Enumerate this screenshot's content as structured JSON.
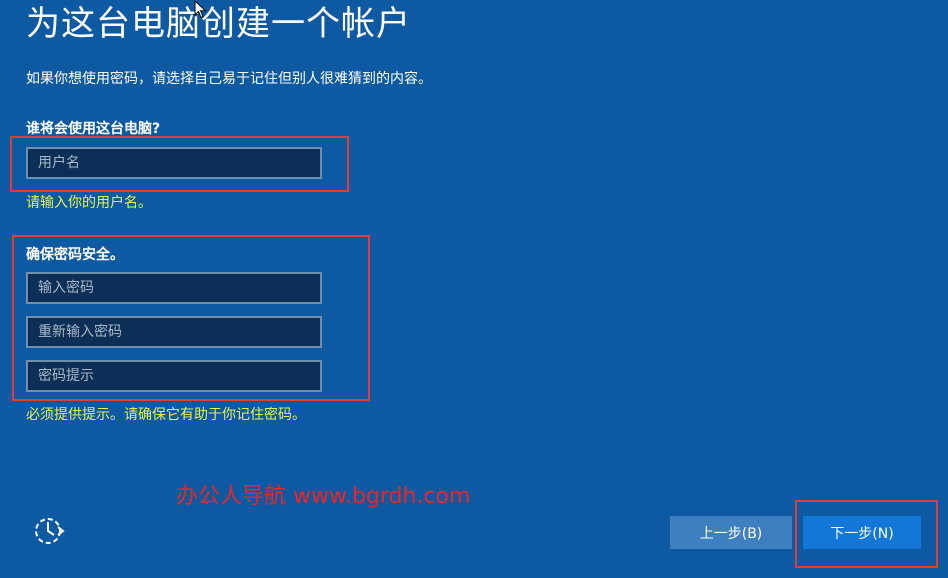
{
  "page": {
    "title": "为这台电脑创建一个帐户",
    "subtitle": "如果你想使用密码，请选择自己易于记住但别人很难猜到的内容。"
  },
  "username_section": {
    "label": "谁将会使用这台电脑?",
    "placeholder": "用户名",
    "value": "",
    "error": "请输入你的用户名。"
  },
  "password_section": {
    "label": "确保密码安全。",
    "password_placeholder": "输入密码",
    "confirm_placeholder": "重新输入密码",
    "hint_placeholder": "密码提示",
    "error": "必须提供提示。请确保它有助于你记住密码。"
  },
  "watermark": "办公人导航  www.bgrdh.com",
  "buttons": {
    "back": "上一步(B)",
    "next": "下一步(N)"
  },
  "icons": {
    "ease_of_access": "ease-of-access-icon",
    "cursor": "mouse-cursor-icon"
  },
  "colors": {
    "background": "#0e5aa2",
    "field_bg": "#0c2f57",
    "error_text": "#e6f253",
    "highlight_box": "#e53a3a",
    "watermark": "#ec2424",
    "next_button": "#1277d6",
    "back_button": "#3d7fbf"
  }
}
